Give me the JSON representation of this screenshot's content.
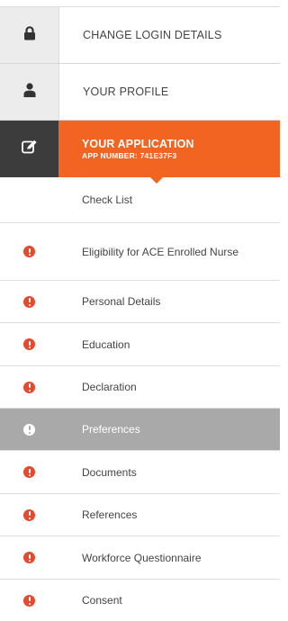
{
  "colors": {
    "accent": "#f26422",
    "active_icon_bg": "#3c3c3c",
    "alert": "#e64a2e",
    "selected_bg": "#a9a9a9"
  },
  "main_nav": [
    {
      "label": "CHANGE LOGIN DETAILS",
      "icon": "lock-icon"
    },
    {
      "label": "YOUR PROFILE",
      "icon": "user-icon"
    }
  ],
  "application": {
    "title": "YOUR APPLICATION",
    "app_number_line": "APP NUMBER: 741E37F3",
    "icon": "edit-icon"
  },
  "sub_items": [
    {
      "label": "Check List",
      "status": "none"
    },
    {
      "label": "Eligibility for ACE Enrolled Nurse",
      "status": "alert-icon"
    },
    {
      "label": "Personal Details",
      "status": "alert-icon"
    },
    {
      "label": "Education",
      "status": "alert-icon"
    },
    {
      "label": "Declaration",
      "status": "alert-icon"
    },
    {
      "label": "Preferences",
      "status": "alert-icon",
      "selected": true
    },
    {
      "label": "Documents",
      "status": "alert-icon"
    },
    {
      "label": "References",
      "status": "alert-icon"
    },
    {
      "label": "Workforce Questionnaire",
      "status": "alert-icon"
    },
    {
      "label": "Consent",
      "status": "alert-icon"
    }
  ]
}
